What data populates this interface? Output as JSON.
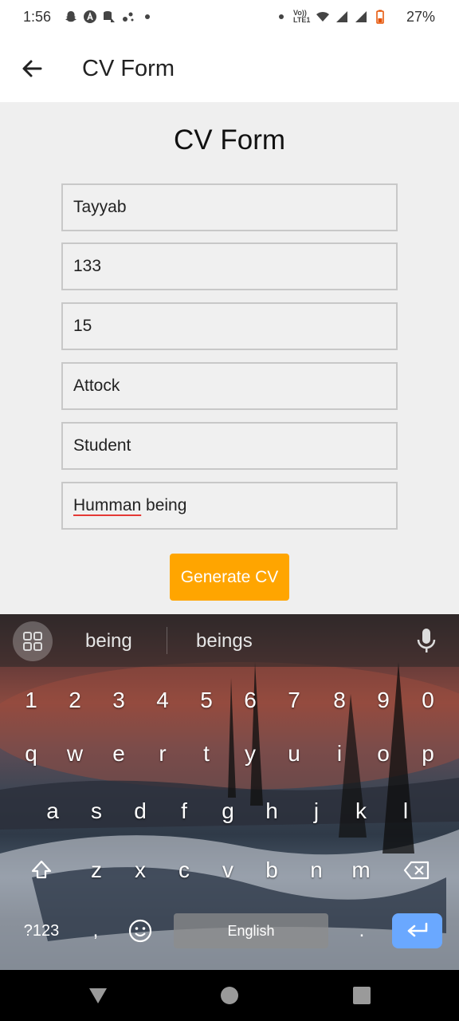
{
  "status_bar": {
    "time": "1:56",
    "battery_percent": "27%",
    "network_label": "Vo)) LTE1",
    "left_icons": [
      "snapchat-icon",
      "a-notification-icon",
      "sd-card-icon",
      "sync-icon",
      "dot-icon"
    ],
    "right_icons": [
      "dot-icon",
      "volte-icon",
      "wifi-icon",
      "signal-icon",
      "signal-icon",
      "battery-icon"
    ]
  },
  "app_bar": {
    "title": "CV Form",
    "back_icon": "arrow-back-icon"
  },
  "form": {
    "heading": "CV Form",
    "fields": [
      {
        "name": "name",
        "value": "Tayyab"
      },
      {
        "name": "number",
        "value": "133"
      },
      {
        "name": "age",
        "value": "15"
      },
      {
        "name": "city",
        "value": "Attock"
      },
      {
        "name": "profession",
        "value": "Student"
      },
      {
        "name": "about",
        "value_misspelled": "Humman",
        "value_rest": " being"
      }
    ],
    "generate_button": "Generate CV",
    "accent_color": "#ffa500"
  },
  "keyboard": {
    "suggestions": [
      "being",
      "beings"
    ],
    "number_row": [
      "1",
      "2",
      "3",
      "4",
      "5",
      "6",
      "7",
      "8",
      "9",
      "0"
    ],
    "row1": [
      "q",
      "w",
      "e",
      "r",
      "t",
      "y",
      "u",
      "i",
      "o",
      "p"
    ],
    "row2": [
      "a",
      "s",
      "d",
      "f",
      "g",
      "h",
      "j",
      "k",
      "l"
    ],
    "row3": [
      "z",
      "x",
      "c",
      "v",
      "b",
      "n",
      "m"
    ],
    "symbols_key": "?123",
    "comma_key": ",",
    "period_key": ".",
    "space_label": "English",
    "enter_color": "#6aa8ff"
  },
  "nav_bar": {
    "buttons": [
      "back-triangle-icon",
      "home-circle-icon",
      "recents-square-icon"
    ]
  }
}
